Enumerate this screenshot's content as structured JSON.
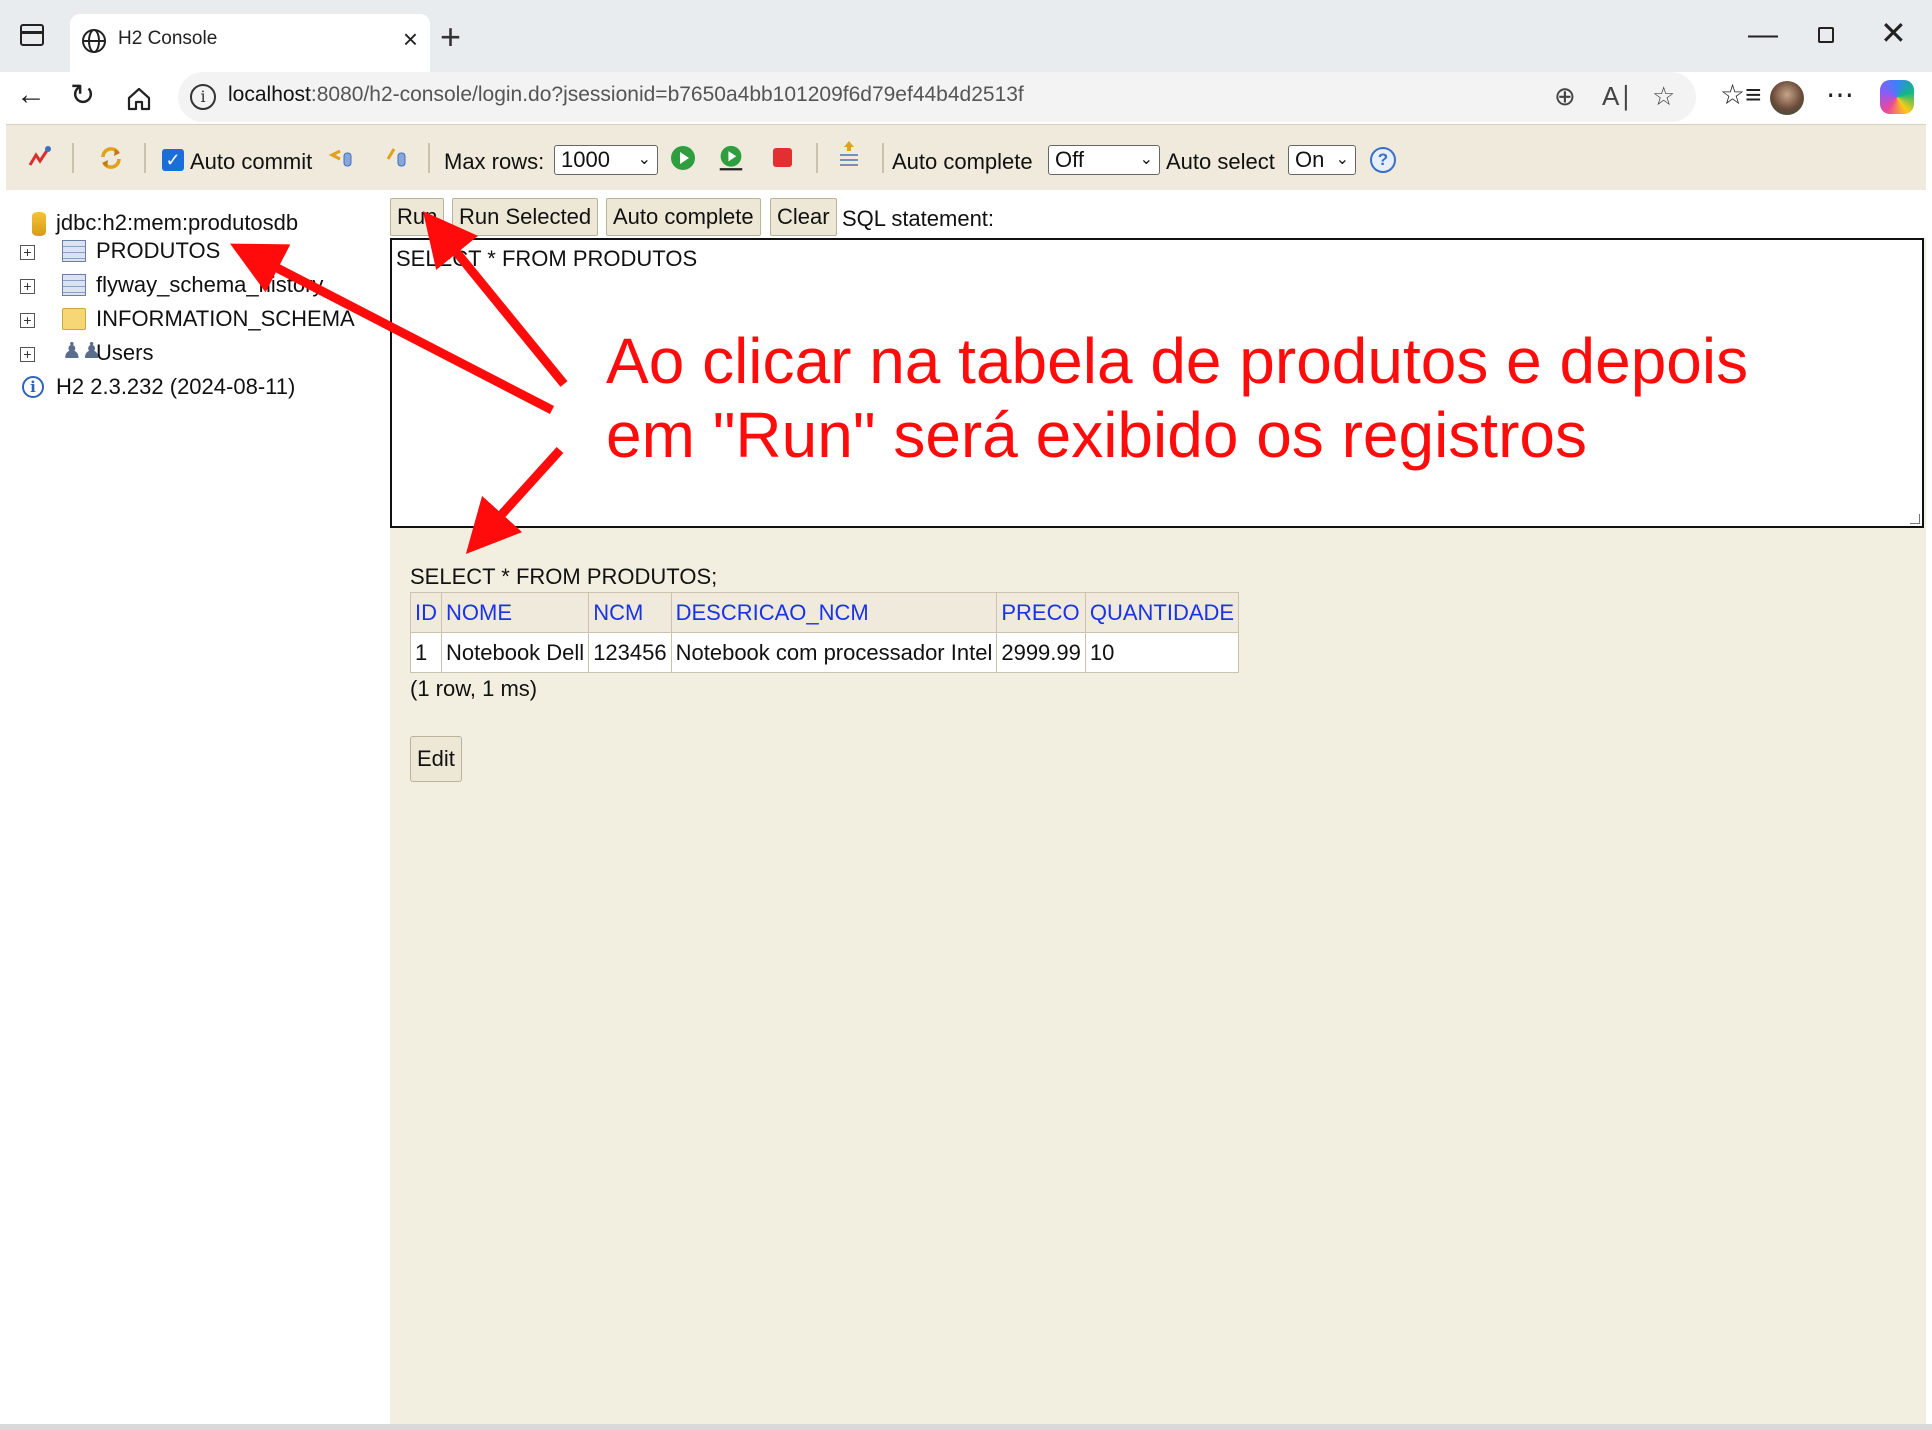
{
  "browser": {
    "tab_title": "H2 Console",
    "tab_close": "×",
    "new_tab": "+",
    "window_minimize": "—",
    "window_close": "✕",
    "url_host": "localhost",
    "url_rest": ":8080/h2-console/login.do?jsessionid=b7650a4bb101209f6d79ef44b4d2513f"
  },
  "h2_toolbar": {
    "auto_commit_label": "Auto commit",
    "max_rows_label": "Max rows:",
    "max_rows_value": "1000",
    "auto_complete_label": "Auto complete",
    "auto_complete_value": "Off",
    "auto_select_label": "Auto select",
    "auto_select_value": "On",
    "help": "?"
  },
  "tree": {
    "connection": "jdbc:h2:mem:produtosdb",
    "items": [
      {
        "label": "PRODUTOS"
      },
      {
        "label": "flyway_schema_history"
      },
      {
        "label": "INFORMATION_SCHEMA"
      },
      {
        "label": "Users"
      }
    ],
    "version": "H2 2.3.232 (2024-08-11)"
  },
  "commands": {
    "run": "Run",
    "run_selected": "Run Selected",
    "auto_complete": "Auto complete",
    "clear": "Clear",
    "sql_statement_label": "SQL statement:"
  },
  "editor": {
    "sql": "SELECT * FROM PRODUTOS"
  },
  "result": {
    "query": "SELECT * FROM PRODUTOS;",
    "columns": [
      "ID",
      "NOME",
      "NCM",
      "DESCRICAO_NCM",
      "PRECO",
      "QUANTIDADE"
    ],
    "rows": [
      [
        "1",
        "Notebook Dell",
        "123456",
        "Notebook com processador Intel",
        "2999.99",
        "10"
      ]
    ],
    "meta": "(1 row, 1 ms)",
    "edit_button": "Edit"
  },
  "annotation": {
    "line1": "Ao clicar na tabela de produtos e depois",
    "line2": "em \"Run\" será exibido os registros",
    "color": "#ff0b0b"
  }
}
